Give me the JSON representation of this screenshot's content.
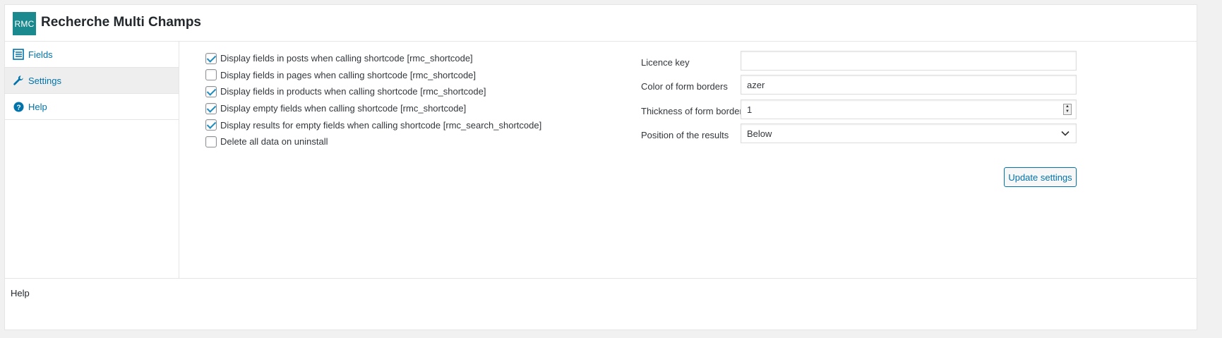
{
  "app": {
    "logo_text": "RMC",
    "title": "Recherche Multi Champs",
    "accent": "#1b8a8f"
  },
  "sidebar": {
    "items": [
      {
        "label": "Fields",
        "icon": "list-icon",
        "active": false
      },
      {
        "label": "Settings",
        "icon": "wrench-icon",
        "active": true
      },
      {
        "label": "Help",
        "icon": "help-icon",
        "active": false
      }
    ]
  },
  "options": [
    {
      "label": "Display fields in posts when calling shortcode [rmc_shortcode]",
      "checked": true
    },
    {
      "label": "Display fields in pages when calling shortcode [rmc_shortcode]",
      "checked": false
    },
    {
      "label": "Display fields in products when calling shortcode [rmc_shortcode]",
      "checked": true
    },
    {
      "label": "Display empty fields when calling shortcode [rmc_shortcode]",
      "checked": true
    },
    {
      "label": "Display results for empty fields when calling shortcode [rmc_search_shortcode]",
      "checked": true
    },
    {
      "label": "Delete all data on uninstall",
      "checked": false
    }
  ],
  "form": {
    "licence_key": {
      "label": "Licence key",
      "value": ""
    },
    "border_color": {
      "label": "Color of form borders",
      "value": "azer"
    },
    "border_thickness": {
      "label": "Thickness of form borders",
      "value": "1"
    },
    "results_position": {
      "label": "Position of the results",
      "value": "Below"
    }
  },
  "update_button": "Update settings",
  "footer": {
    "label": "Help"
  }
}
